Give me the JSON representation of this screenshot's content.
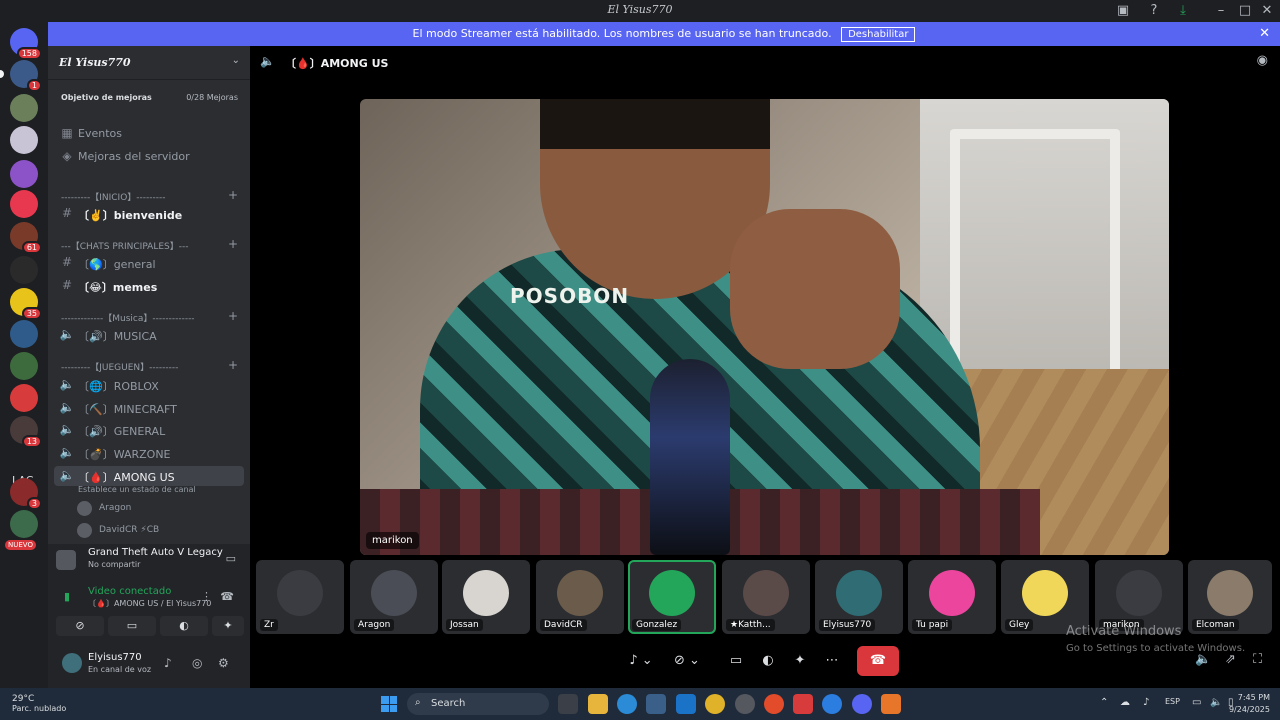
{
  "window": {
    "title": "El Yisus770"
  },
  "banner": {
    "text": "El modo Streamer está habilitado. Los nombres de usuario se han truncado.",
    "button": "Deshabilitar"
  },
  "guilds": {
    "dm_badge": "158",
    "badges": [
      "1",
      "61",
      "35",
      "13",
      "3"
    ],
    "lac": "LAC",
    "nuevo": "NUEVO"
  },
  "server": {
    "name": "El Yisus770",
    "boost_label": "Objetivo de mejoras",
    "boost_count": "0/28 Mejoras",
    "events": "Eventos",
    "server_boosts": "Mejoras del servidor"
  },
  "categories": {
    "inicio": "---------【INICIO】---------",
    "chats": "---【CHATS PRINCIPALES】---",
    "musica": "-------------【Musica】-------------",
    "juegen": "---------【JUEGUEN】---------"
  },
  "channels": {
    "bienvenide": "〔✌️〕bienvenide",
    "general": "〔🌎〕general",
    "memes": "〔😂〕memes",
    "musica": "〔🔊〕MUSICA",
    "roblox": "〔🌐〕ROBLOX",
    "minecraft": "〔⛏️〕MINECRAFT",
    "general_voice": "〔🔊〕GENERAL",
    "warzone": "〔💣〕WARZONE",
    "among_us": "〔🩸〕AMONG US",
    "status_placeholder": "Establece un estado de canal"
  },
  "voice_users": [
    {
      "name": "Aragon"
    },
    {
      "name": "DavidCR",
      "tag": "⚡CB"
    }
  ],
  "activity": {
    "game": "Grand Theft Auto V Legacy",
    "sub": "No compartir"
  },
  "voice_panel": {
    "status": "Video conectado",
    "location": "〔🩸〕AMONG US / El Yisus770"
  },
  "user_panel": {
    "name": "Elyisus770",
    "status": "En canal de voz"
  },
  "stage": {
    "title": "〔🩸〕AMONG US",
    "focused_user": "marikon",
    "shirt_text": "POSOBON"
  },
  "tiles": [
    {
      "name": "Zr",
      "color": "#3a3c42"
    },
    {
      "name": "Aragon",
      "color": "#4a4d55"
    },
    {
      "name": "Jossan",
      "color": "#d8d4cf"
    },
    {
      "name": "DavidCR",
      "color": "#6b5b4a"
    },
    {
      "name": "Gonzalez",
      "color": "#23a55a"
    },
    {
      "name": "★Katth...",
      "color": "#5a4a48"
    },
    {
      "name": "Elyisus770",
      "color": "#2f6c74"
    },
    {
      "name": "Tu papi",
      "color": "#eb459e"
    },
    {
      "name": "Gley",
      "color": "#f0d75a"
    },
    {
      "name": "marikon",
      "color": "#3a3c42"
    },
    {
      "name": "Elcoman",
      "color": "#8a7b6a"
    }
  ],
  "watermark": {
    "line1": "Activate Windows",
    "line2": "Go to Settings to activate Windows."
  },
  "taskbar": {
    "temp": "29°C",
    "weather": "Parc. nublado",
    "search": "Search",
    "lang": "ESP",
    "time": "7:45 PM",
    "date": "9/24/2025"
  }
}
